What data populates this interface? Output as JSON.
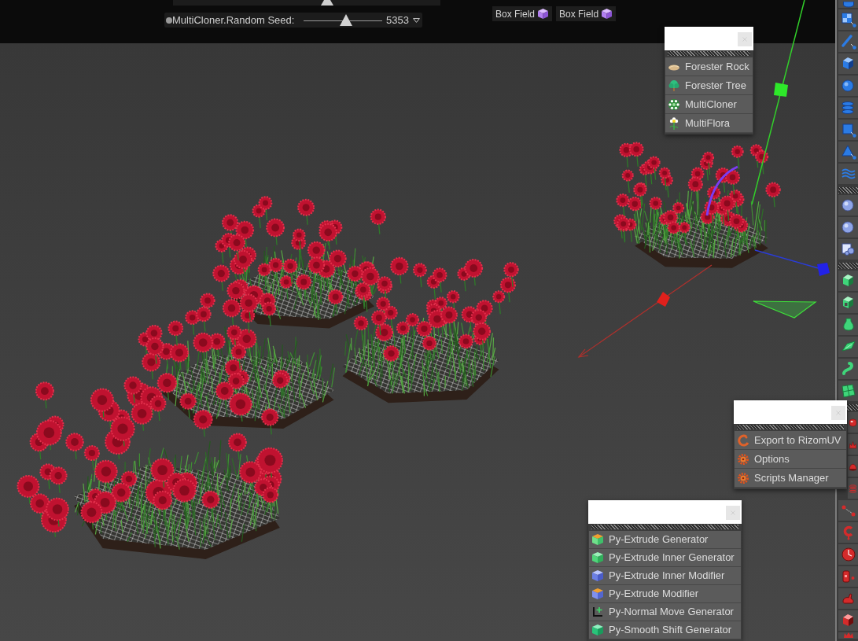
{
  "header": {
    "clipped_slider": {
      "level": 0.19
    },
    "seed_slider": {
      "label": "MultiCloner.Random Seed:",
      "value": "5353",
      "level": 0.54
    },
    "field_buttons": [
      {
        "label": "Box Field"
      },
      {
        "label": "Box Field"
      }
    ]
  },
  "palettes": [
    {
      "items": [
        {
          "label": "Forester Rock"
        },
        {
          "label": "Forester Tree"
        },
        {
          "label": "MultiCloner"
        },
        {
          "label": "MultiFlora"
        }
      ]
    },
    {
      "items": [
        {
          "label": "Export to RizomUV"
        },
        {
          "label": "Options"
        },
        {
          "label": "Scripts Manager"
        }
      ]
    },
    {
      "items": [
        {
          "label": "Py-Extrude Generator"
        },
        {
          "label": "Py-Extrude Inner Generator"
        },
        {
          "label": "Py-Extrude Inner Modifier"
        },
        {
          "label": "Py-Extrude Modifier"
        },
        {
          "label": "Py-Normal Move Generator"
        },
        {
          "label": "Py-Smooth Shift Generator"
        }
      ]
    }
  ]
}
